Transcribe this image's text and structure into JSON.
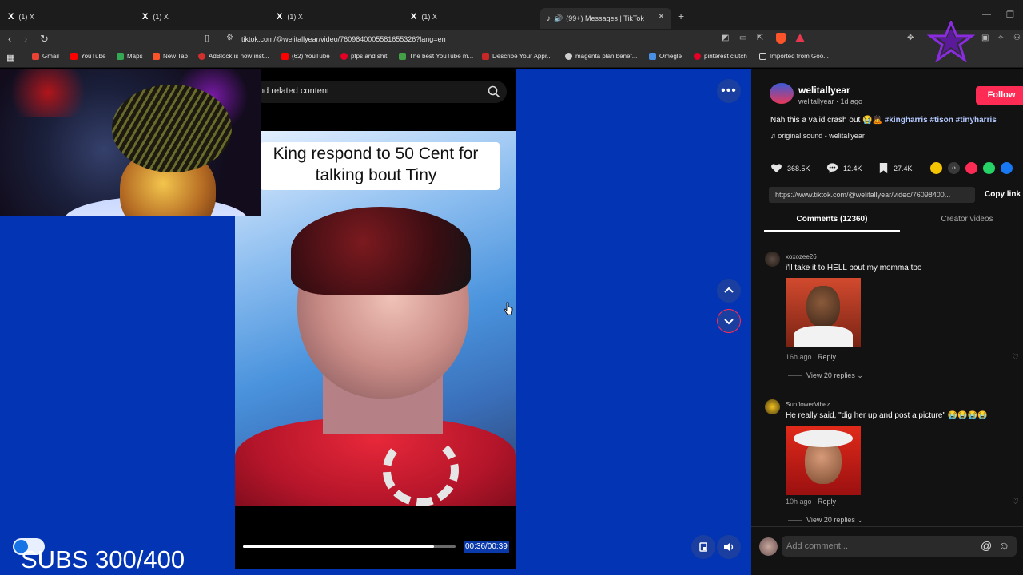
{
  "browser": {
    "tabs": [
      {
        "label": "(1) X"
      },
      {
        "label": "(1) X"
      },
      {
        "label": "(1) X"
      },
      {
        "label": "(1) X"
      },
      {
        "label": "(99+) Messages | TikTok"
      }
    ],
    "url": "tiktok.com/@welitallyear/video/7609840005581655326?lang=en",
    "bookmarks": [
      {
        "label": "Gmail",
        "color": "#ea4335"
      },
      {
        "label": "YouTube",
        "color": "#ff0000"
      },
      {
        "label": "Maps",
        "color": "#34a853"
      },
      {
        "label": "New Tab",
        "color": "#fb542b"
      },
      {
        "label": "AdBlock is now inst...",
        "color": "#d32f2f"
      },
      {
        "label": "(62) YouTube",
        "color": "#ff0000"
      },
      {
        "label": "pfps and shit",
        "color": "#e60023"
      },
      {
        "label": "The best YouTube m...",
        "color": "#43a047"
      },
      {
        "label": "Describe Your Appr...",
        "color": "#c62828"
      },
      {
        "label": "magenta plan benef...",
        "color": "#cfcfcf"
      },
      {
        "label": "Omegle",
        "color": "#4a90e2"
      },
      {
        "label": "pinterest clutch",
        "color": "#e60023"
      },
      {
        "label": "Imported from Goo...",
        "color": "#d8d8d8"
      }
    ]
  },
  "video": {
    "search_placeholder": "nd related content",
    "caption_line1": "King respond to 50 Cent for",
    "caption_line2": "talking bout Tiny",
    "time": "00:36/00:39",
    "progress": 0.9
  },
  "overlay": {
    "subs_text": "SUBS 300/400"
  },
  "post": {
    "author": "welitallyear",
    "meta": "welitallyear · 1d ago",
    "follow_label": "Follow",
    "description": "Nah this a valid crash out 😭🙇",
    "hashtags": "#kingharris #tison #tinyharris",
    "sound": "original sound - welitallyear",
    "likes": "368.5K",
    "comments_count": "12.4K",
    "saves": "27.4K",
    "link": "https://www.tiktok.com/@welitallyear/video/76098400...",
    "copy_label": "Copy link",
    "tab_comments": "Comments (12360)",
    "tab_creator": "Creator videos"
  },
  "comments": [
    {
      "user": "xoxozee26",
      "text": "i'll take it to HELL bout my momma too",
      "time": "16h ago",
      "reply_label": "Reply",
      "view_replies": "View 20 replies"
    },
    {
      "user": "SunflowerVibez",
      "text": "He really said, \"dig her up and post a picture\" 😭😭😭😭",
      "time": "10h ago",
      "reply_label": "Reply",
      "view_replies": "View 20 replies"
    }
  ],
  "comment_bar": {
    "placeholder": "Add comment..."
  },
  "colors": {
    "page_bg": "#0234b4",
    "accent": "#fe2c55"
  }
}
